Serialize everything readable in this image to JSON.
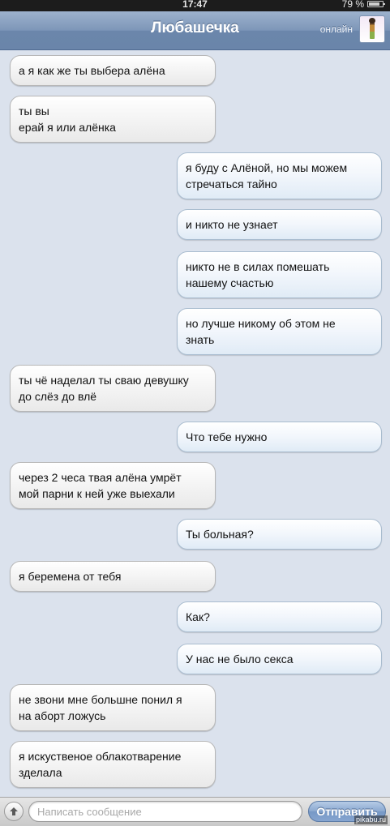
{
  "status_bar": {
    "time": "17:47",
    "battery": "79 %"
  },
  "header": {
    "title": "Любашечка",
    "status": "онлайн"
  },
  "messages": [
    {
      "direction": "in",
      "lines": [
        "а я как же ты выбера алёна"
      ]
    },
    {
      "direction": "in",
      "lines": [
        "ты вы",
        "ерай я или алёнка"
      ]
    },
    {
      "direction": "out",
      "lines": [
        "я буду с Алёной, но мы можем",
        "стречаться тайно"
      ]
    },
    {
      "direction": "out",
      "lines": [
        "и никто не узнает"
      ]
    },
    {
      "direction": "out",
      "lines": [
        "никто не в силах помешать",
        "нашему счастью"
      ]
    },
    {
      "direction": "out",
      "lines": [
        "но лучше никому об этом не",
        "знать"
      ]
    },
    {
      "direction": "in",
      "lines": [
        "ты чё наделал ты сваю девушку",
        "до  слёз до влё"
      ]
    },
    {
      "direction": "out",
      "lines": [
        "Что тебе нужно"
      ]
    },
    {
      "direction": "in",
      "lines": [
        "через 2 чеса твая  алёна  умрёт",
        "мой парни к ней  уже  выехали"
      ]
    },
    {
      "direction": "out",
      "lines": [
        "Ты больная?"
      ]
    },
    {
      "direction": "in",
      "lines": [
        "я беремена от тебя"
      ]
    },
    {
      "direction": "out",
      "lines": [
        "Как?"
      ]
    },
    {
      "direction": "out",
      "lines": [
        "У нас не было секса"
      ]
    },
    {
      "direction": "in",
      "lines": [
        "не звони  мне большне   понил я",
        "на аборт ложусь"
      ]
    },
    {
      "direction": "in",
      "lines": [
        "я искуственое облакотварение",
        "зделала"
      ]
    }
  ],
  "input_bar": {
    "placeholder": "Написать сообщение",
    "send_label": "Отправить"
  },
  "watermark": "pikabu.ru"
}
